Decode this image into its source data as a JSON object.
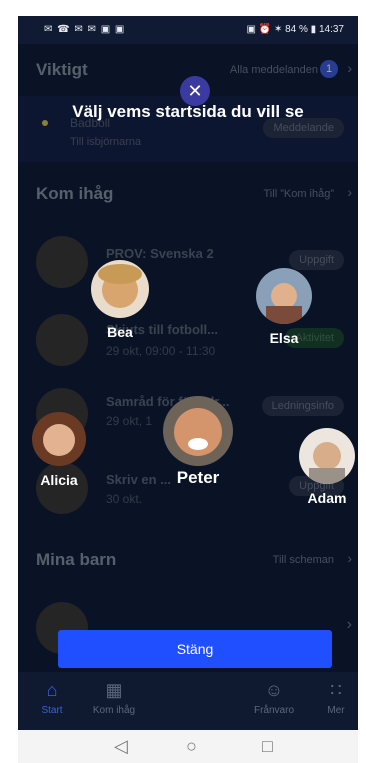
{
  "status": {
    "left_icons": "✉ ☎ ✉ ✉ ▣ ▣",
    "right": "▣ ⏰ ✶ 84 % ▮ 14:37"
  },
  "important": {
    "title": "Viktigt",
    "link": "Alla meddelanden",
    "badge": "1",
    "item_title": "Badboll",
    "item_sub": "Till isbjörnarna",
    "item_tag": "Meddelande"
  },
  "remember": {
    "title": "Kom ihåg",
    "link": "Till ”Kom ihåg”",
    "rows": [
      {
        "title": "PROV: Svenska 2",
        "sub": "",
        "tag": "Uppgift"
      },
      {
        "title": "Skjuts till fotboll...",
        "sub": "29 okt, 09:00 - 11:30",
        "tag": "Aktivitet"
      },
      {
        "title": "Samråd för föräldr...",
        "sub": "29 okt, 1",
        "tag": "Ledningsinfo"
      },
      {
        "title": "Skriv en ...",
        "sub": "30 okt.",
        "tag": "Uppgift"
      }
    ]
  },
  "kids_section": {
    "title": "Mina barn",
    "link": "Till scheman"
  },
  "overlay": {
    "title": "Välj vems startsida du vill se",
    "close_icon": "✕",
    "kids": [
      {
        "name": "Bea",
        "color": "#d9a56e"
      },
      {
        "name": "Elsa",
        "color": "#8aa0b8"
      },
      {
        "name": "Alicia",
        "color": "#b77a52"
      },
      {
        "name": "Peter",
        "color": "#c98e66"
      },
      {
        "name": "Adam",
        "color": "#c4b6a6"
      }
    ],
    "close_button": "Stäng"
  },
  "nav": {
    "items": [
      {
        "label": "Start",
        "icon": "⌂"
      },
      {
        "label": "Kom ihåg",
        "icon": "▦"
      },
      {
        "label": "Frånvaro",
        "icon": "☺"
      },
      {
        "label": "Mer",
        "icon": "∷"
      }
    ]
  },
  "android": {
    "back": "◁",
    "home": "○",
    "recent": "□"
  }
}
